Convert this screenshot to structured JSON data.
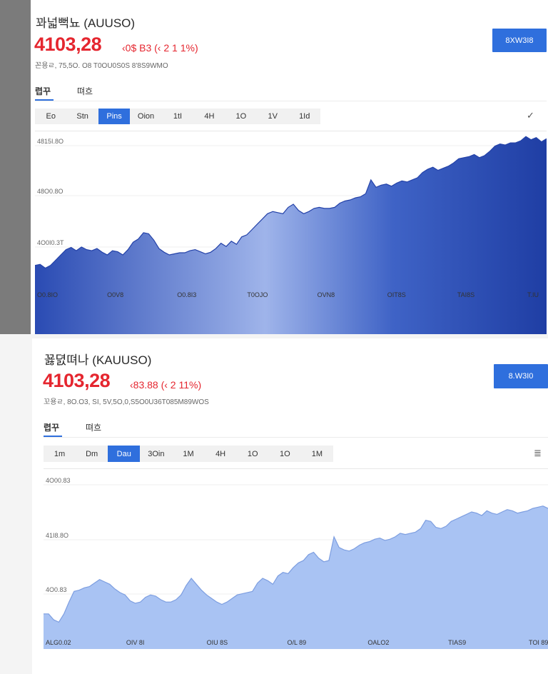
{
  "panel1": {
    "title": "꽈넓뻑뇨 (AUUSO)",
    "price": "4103,28",
    "change": "‹0$ B3 (‹ 2 1 1%)",
    "subline": "꼰용ㄹ,  75,5O. O8  T0OU0S0S 8'8S9WMO",
    "action_label": "8XW3I8",
    "tabs": [
      {
        "label": "렵꾸"
      },
      {
        "label": "뗘흐"
      }
    ],
    "ranges": [
      "Eo",
      "Stn",
      "Pins",
      "Oion",
      "1tI",
      "4H",
      "1O",
      "1V",
      "1Id"
    ],
    "active_range": 2,
    "tool_icon": "draw-tool-icon",
    "chart_data": {
      "type": "area",
      "y_labels": [
        "4815I.8O",
        "48O0.8O",
        "4O0I0.3T"
      ],
      "x_labels": [
        "O0.8IO",
        "O0V8",
        "O0.8I3",
        "T0OJO",
        "OVN8",
        "OIT8S",
        "TAI8S",
        "T.IU"
      ],
      "values": [
        30,
        32,
        25,
        30,
        40,
        50,
        60,
        64,
        58,
        65,
        60,
        58,
        62,
        55,
        50,
        58,
        56,
        50,
        60,
        74,
        80,
        92,
        90,
        78,
        62,
        55,
        50,
        52,
        54,
        54,
        58,
        60,
        56,
        52,
        55,
        62,
        72,
        66,
        76,
        70,
        84,
        88,
        98,
        108,
        118,
        128,
        132,
        130,
        128,
        140,
        146,
        134,
        128,
        132,
        138,
        140,
        138,
        138,
        140,
        148,
        152,
        154,
        158,
        160,
        166,
        192,
        178,
        182,
        184,
        180,
        186,
        190,
        188,
        192,
        196,
        206,
        212,
        216,
        210,
        214,
        218,
        224,
        232,
        234,
        236,
        240,
        234,
        238,
        246,
        256,
        260,
        258,
        262,
        262,
        266,
        274,
        268,
        272,
        264,
        270
      ]
    }
  },
  "panel2": {
    "title": "꾫뎘뗘나 (KAUUSO)",
    "price": "4103,28",
    "change": "‹83.88 (‹ 2 11%)",
    "subline": "꼬용ㄹ,  8O.O3,  SI, 5V,5O,0,S5O0U36T085M89WOS",
    "action_label": "8.W3I0",
    "tabs": [
      {
        "label": "렵꾸"
      },
      {
        "label": "뗘흐"
      }
    ],
    "ranges": [
      "1m",
      "Dm",
      "Dau",
      "3Oin",
      "1M",
      "4H",
      "1O",
      "1O",
      "1M"
    ],
    "active_range": 2,
    "tool_icon": "settings-tool-icon",
    "chart_data": {
      "type": "area",
      "y_labels": [
        "4O00.83",
        "41I8.8O",
        "4O0.83"
      ],
      "x_labels": [
        "ALG0.02",
        "OIV 8I",
        "OIU 8S",
        "O/L 89",
        "OALO2",
        "TIAS9",
        "TOI 89"
      ],
      "values": [
        40,
        40,
        30,
        26,
        40,
        60,
        78,
        80,
        84,
        86,
        92,
        98,
        94,
        90,
        82,
        76,
        72,
        62,
        58,
        60,
        68,
        72,
        70,
        64,
        60,
        60,
        64,
        72,
        88,
        100,
        90,
        80,
        72,
        66,
        60,
        56,
        60,
        66,
        72,
        74,
        76,
        78,
        92,
        100,
        96,
        90,
        104,
        110,
        108,
        118,
        126,
        130,
        140,
        144,
        134,
        128,
        130,
        170,
        152,
        148,
        146,
        150,
        156,
        160,
        162,
        166,
        168,
        164,
        166,
        170,
        176,
        174,
        176,
        178,
        184,
        198,
        196,
        186,
        184,
        188,
        196,
        200,
        204,
        208,
        212,
        210,
        206,
        214,
        210,
        208,
        212,
        216,
        214,
        210,
        212,
        214,
        218,
        220,
        222,
        218
      ]
    }
  }
}
